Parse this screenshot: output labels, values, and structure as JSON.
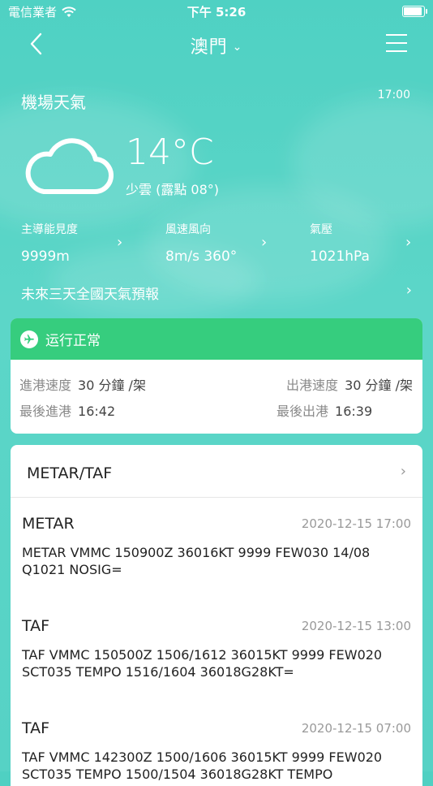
{
  "status_bar": {
    "carrier": "電信業者",
    "time": "下午 5:26"
  },
  "nav": {
    "title": "澳門"
  },
  "weather": {
    "title": "機場天氣",
    "time": "17:00",
    "temperature": "14°C",
    "description": "少雲 (露點 08°)",
    "metrics": [
      {
        "label": "主導能見度",
        "value": "9999m"
      },
      {
        "label": "風速風向",
        "value": "8m/s 360°"
      },
      {
        "label": "氣壓",
        "value": "1021hPa"
      }
    ],
    "forecast_link": "未來三天全國天氣預報"
  },
  "operation": {
    "status": "运行正常",
    "status_color": "#36cd7e",
    "arrival_rate_label": "進港速度",
    "arrival_rate_value": "30 分鐘 /架",
    "departure_rate_label": "出港速度",
    "departure_rate_value": "30 分鐘 /架",
    "last_arrival_label": "最後進港",
    "last_arrival_value": "16:42",
    "last_departure_label": "最後出港",
    "last_departure_value": "16:39"
  },
  "metar_taf": {
    "header": "METAR/TAF",
    "entries": [
      {
        "type": "METAR",
        "date": "2020-12-15 17:00",
        "text": "METAR VMMC 150900Z 36016KT 9999 FEW030 14/08 Q1021 NOSIG="
      },
      {
        "type": "TAF",
        "date": "2020-12-15 13:00",
        "text": "TAF VMMC 150500Z 1506/1612 36015KT 9999 FEW020 SCT035  TEMPO 1516/1604 36018G28KT="
      },
      {
        "type": "TAF",
        "date": "2020-12-15 07:00",
        "text": "TAF VMMC 142300Z 1500/1606 36015KT 9999 FEW020 SCT035  TEMPO 1500/1504 36018G28KT  TEMPO"
      }
    ]
  },
  "icons": {
    "back": "chevron-left-icon",
    "dropdown": "chevron-down-icon",
    "menu": "hamburger-menu-icon",
    "weather": "cloud-icon",
    "plane": "airplane-icon",
    "wifi": "wifi-icon",
    "battery": "battery-icon"
  }
}
